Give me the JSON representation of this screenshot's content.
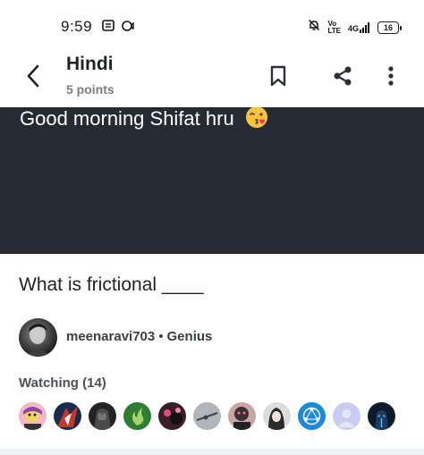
{
  "status_bar": {
    "time": "9:59",
    "volte_label_top": "Vo",
    "volte_label_bottom": "LTE",
    "network": "4G",
    "battery": "16"
  },
  "header": {
    "title": "Hindi",
    "subtitle": "5 points"
  },
  "question": {
    "image_text": "Good morning Shifat hru",
    "text": "What is frictional ____"
  },
  "author": {
    "username": "meenaravi703",
    "separator": "•",
    "rank": "Genius"
  },
  "watching": {
    "label": "Watching (14)",
    "avatars": [
      "watcher-1",
      "watcher-2",
      "watcher-3",
      "watcher-4",
      "watcher-5",
      "watcher-6",
      "watcher-7",
      "watcher-8",
      "watcher-9",
      "watcher-10",
      "watcher-11"
    ]
  },
  "colors": {
    "image_background": "#262b33",
    "title_text": "#1f2328",
    "muted_text": "#7a7f86"
  }
}
